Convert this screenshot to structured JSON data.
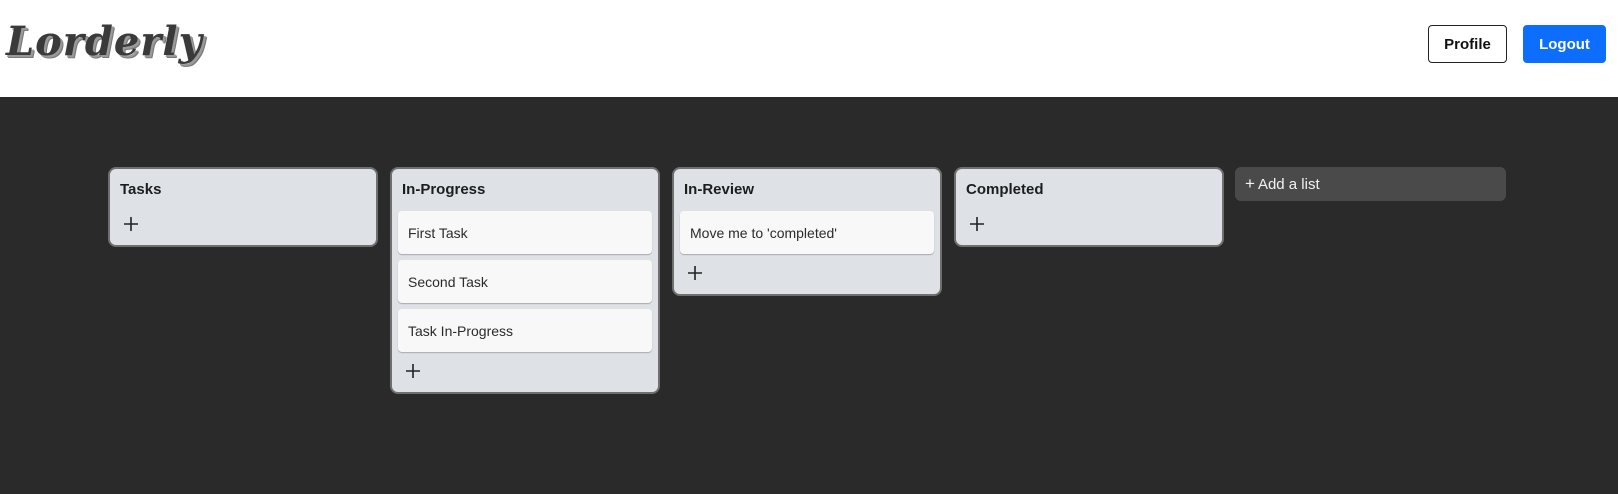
{
  "header": {
    "logo_text": "Lorderly",
    "profile_label": "Profile",
    "logout_label": "Logout"
  },
  "board": {
    "lists": [
      {
        "title": "Tasks",
        "cards": []
      },
      {
        "title": "In-Progress",
        "cards": [
          "First Task",
          "Second Task",
          "Task In-Progress"
        ]
      },
      {
        "title": "In-Review",
        "cards": [
          "Move me to 'completed'"
        ]
      },
      {
        "title": "Completed",
        "cards": []
      }
    ],
    "add_list_label": "Add a list",
    "add_list_icon": "plus-icon",
    "add_card_icon": "plus-icon"
  },
  "colors": {
    "board_bg": "#2a2a2a",
    "list_bg": "#dee2e6",
    "card_bg": "#f8f8f8",
    "logout_bg": "#0d6efd"
  }
}
